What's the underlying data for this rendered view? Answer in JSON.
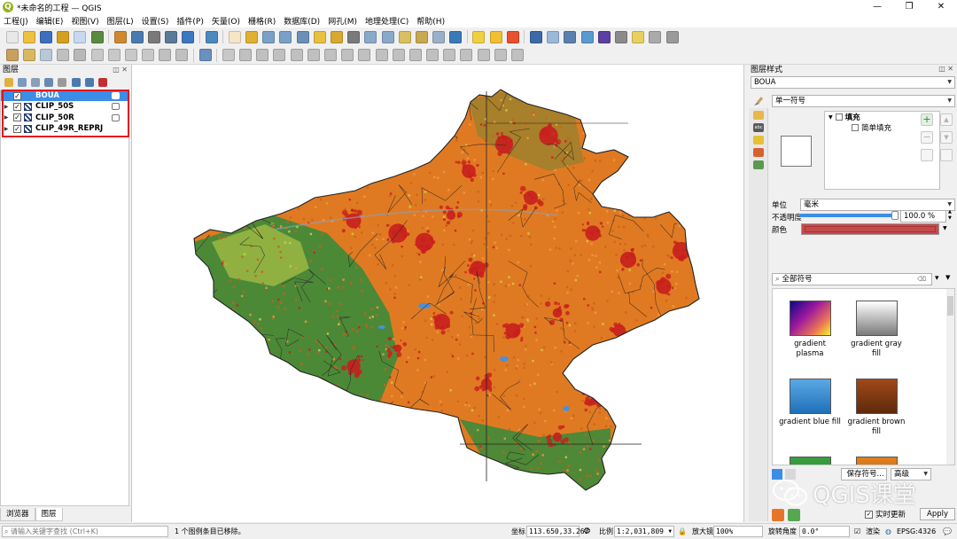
{
  "window": {
    "title": "*未命名的工程 — QGIS",
    "app_logo": "Q",
    "minimize": "—",
    "maximize": "❐",
    "close": "✕"
  },
  "menu": [
    "工程(J)",
    "编辑(E)",
    "视图(V)",
    "图层(L)",
    "设置(S)",
    "插件(P)",
    "矢量(O)",
    "栅格(R)",
    "数据库(D)",
    "网孔(M)",
    "地理处理(C)",
    "帮助(H)"
  ],
  "toolbar1_icons": [
    {
      "name": "new-project-icon",
      "color": "#e8e8e8"
    },
    {
      "name": "open-project-icon",
      "color": "#f0c040"
    },
    {
      "name": "save-project-icon",
      "color": "#3c6fbf"
    },
    {
      "name": "save-as-icon",
      "color": "#d4a020"
    },
    {
      "name": "print-layout-icon",
      "color": "#c8d8f0"
    },
    {
      "name": "style-manager-icon",
      "color": "#5a8a40"
    },
    {
      "name": "sep",
      "color": ""
    },
    {
      "name": "add-vector-icon",
      "color": "#d08830"
    },
    {
      "name": "add-raster-icon",
      "color": "#4a7ab0"
    },
    {
      "name": "add-delimited-icon",
      "color": "#7a7a7a"
    },
    {
      "name": "add-gps-icon",
      "color": "#5a7a9a"
    },
    {
      "name": "add-wms-icon",
      "color": "#3c78c0"
    },
    {
      "name": "sep",
      "color": ""
    },
    {
      "name": "checkmark-icon",
      "color": "#4a8ac0"
    },
    {
      "name": "sep",
      "color": ""
    },
    {
      "name": "pan-icon",
      "color": "#f5e6c8"
    },
    {
      "name": "pan-to-selection-icon",
      "color": "#e0b030"
    },
    {
      "name": "zoom-in-icon",
      "color": "#7aa0c8"
    },
    {
      "name": "zoom-out-icon",
      "color": "#7aa0c8"
    },
    {
      "name": "zoom-full-icon",
      "color": "#6a90b8"
    },
    {
      "name": "zoom-selection-icon",
      "color": "#e8c040"
    },
    {
      "name": "zoom-layer-icon",
      "color": "#d8a830"
    },
    {
      "name": "zoom-native-icon",
      "color": "#7a7a7a"
    },
    {
      "name": "zoom-last-icon",
      "color": "#8aa8c8"
    },
    {
      "name": "zoom-next-icon",
      "color": "#8aa8c8"
    },
    {
      "name": "new-bookmark-icon",
      "color": "#d8c060"
    },
    {
      "name": "show-bookmarks-icon",
      "color": "#c8a850"
    },
    {
      "name": "temporal-icon",
      "color": "#9ab0c8"
    },
    {
      "name": "refresh-icon",
      "color": "#3a7ab8"
    },
    {
      "name": "sep",
      "color": ""
    },
    {
      "name": "select-features-icon",
      "color": "#f0d040"
    },
    {
      "name": "select-value-icon",
      "color": "#f0c030"
    },
    {
      "name": "deselect-icon",
      "color": "#e85030"
    },
    {
      "name": "sep",
      "color": ""
    },
    {
      "name": "identify-icon",
      "color": "#3a6aa8"
    },
    {
      "name": "attribute-table-icon",
      "color": "#9ab8d8"
    },
    {
      "name": "field-calculator-icon",
      "color": "#5a80b0"
    },
    {
      "name": "processing-toolbox-icon",
      "color": "#5a9ad0"
    },
    {
      "name": "statistics-sigma-icon",
      "color": "#5a40a0"
    },
    {
      "name": "measure-icon",
      "color": "#8a8a8a"
    },
    {
      "name": "map-tips-icon",
      "color": "#e8d060"
    },
    {
      "name": "annotation-icon",
      "color": "#aaaaaa"
    },
    {
      "name": "decorations-icon",
      "color": "#9a9a9a"
    }
  ],
  "toolbar2_icons": [
    {
      "name": "current-edits-icon",
      "color": "#c8a060"
    },
    {
      "name": "toggle-editing-icon",
      "color": "#d8b860"
    },
    {
      "name": "save-edits-icon",
      "color": "#b8c8d8"
    },
    {
      "name": "digitize-icon",
      "color": "#c0c0c0"
    },
    {
      "name": "vertex-tool-icon",
      "color": "#b8b8b8"
    },
    {
      "name": "delete-selected-icon",
      "color": "#c8c8c8"
    },
    {
      "name": "cut-features-icon",
      "color": "#c8c8c8"
    },
    {
      "name": "copy-features-icon",
      "color": "#c8c8c8"
    },
    {
      "name": "paste-features-icon",
      "color": "#c8c8c8"
    },
    {
      "name": "undo-icon",
      "color": "#c0c0c0"
    },
    {
      "name": "redo-icon",
      "color": "#c0c0c0"
    },
    {
      "name": "sep",
      "color": ""
    },
    {
      "name": "database-icon",
      "color": "#6a90c0"
    },
    {
      "name": "sep",
      "color": ""
    },
    {
      "name": "digitize-shape-icon",
      "color": "#c8c8c8"
    },
    {
      "name": "move-feature-icon",
      "color": "#c0c0c0"
    },
    {
      "name": "rotate-feature-icon",
      "color": "#c0c0c0"
    },
    {
      "name": "simplify-icon",
      "color": "#c0c0c0"
    },
    {
      "name": "add-ring-icon",
      "color": "#c0c0c0"
    },
    {
      "name": "add-part-icon",
      "color": "#c0c0c0"
    },
    {
      "name": "fill-ring-icon",
      "color": "#c0c0c0"
    },
    {
      "name": "delete-ring-icon",
      "color": "#c0c0c0"
    },
    {
      "name": "delete-part-icon",
      "color": "#c0c0c0"
    },
    {
      "name": "reshape-icon",
      "color": "#c0c0c0"
    },
    {
      "name": "offset-curve-icon",
      "color": "#c0c0c0"
    },
    {
      "name": "split-features-icon",
      "color": "#c0c0c0"
    },
    {
      "name": "split-parts-icon",
      "color": "#c0c0c0"
    },
    {
      "name": "merge-features-icon",
      "color": "#c0c0c0"
    },
    {
      "name": "merge-attributes-icon",
      "color": "#c0c0c0"
    },
    {
      "name": "rotate-point-icon",
      "color": "#c0c0c0"
    },
    {
      "name": "trim-extend-icon",
      "color": "#c0c0c0"
    },
    {
      "name": "label-tool-icon",
      "color": "#c0c0c0"
    }
  ],
  "layers_panel": {
    "title": "图层",
    "buttons": "◫ ✕",
    "toolbar_icons": [
      {
        "name": "open-styling-icon",
        "color": "#e0b040"
      },
      {
        "name": "add-group-icon",
        "color": "#7a9ac0"
      },
      {
        "name": "manage-visibility-icon",
        "color": "#8aa0b8"
      },
      {
        "name": "filter-legend-icon",
        "color": "#6a8ab0"
      },
      {
        "name": "filter-expression-icon",
        "color": "#9a9a9a"
      },
      {
        "name": "expand-all-icon",
        "color": "#4a7ab0"
      },
      {
        "name": "collapse-all-icon",
        "color": "#4a7ab0"
      },
      {
        "name": "remove-layer-icon",
        "color": "#c03030"
      }
    ],
    "layers": [
      {
        "name": "BOUA",
        "selected": true,
        "checked": "✓",
        "expand": "",
        "swatch": "#3c8de6",
        "right_icon": "filter"
      },
      {
        "name": "CLIP_50S",
        "selected": false,
        "checked": "✓",
        "expand": "▶",
        "swatch": "#1f3a6e",
        "right_icon": "indicator"
      },
      {
        "name": "CLIP_50R",
        "selected": false,
        "checked": "✓",
        "expand": "▶",
        "swatch": "#1f3a6e",
        "right_icon": "indicator"
      },
      {
        "name": "CLIP_49R_REPRJ",
        "selected": false,
        "checked": "✓",
        "expand": "▶",
        "swatch": "#1f3a6e",
        "right_icon": ""
      }
    ],
    "tabs": [
      "浏览器",
      "图层"
    ]
  },
  "style_panel": {
    "title": "图层样式",
    "buttons": "◫ ✕",
    "layer_combo": "BOUA",
    "renderer_combo": "单一符号",
    "tree": {
      "root": "填充",
      "child": "简单填充",
      "root_arrow": "▼"
    },
    "unit_label": "单位",
    "unit_value": "毫米",
    "opacity_label": "不透明度",
    "opacity_value": "100.0 %",
    "opacity_fraction": 1.0,
    "color_label": "颜色",
    "color_value": "#c44b4b",
    "search_placeholder": "全部符号",
    "symbols": [
      {
        "label": "gradient\nplasma",
        "gradient": "linear-gradient(135deg,#0d0887 0%,#9c179e 40%,#ed7953 75%,#f0f921 100%)"
      },
      {
        "label": "gradient  gray\nfill",
        "gradient": "linear-gradient(180deg,#ffffff 0%,#7a7a7a 100%)"
      },
      {
        "label": "gradient blue fill",
        "gradient": "linear-gradient(180deg,#5aa9e6 0%,#1f70b8 100%)"
      },
      {
        "label": "gradient brown\nfill",
        "gradient": "linear-gradient(180deg,#a0481a 0%,#5e2a0c 100%)"
      },
      {
        "label": "",
        "gradient": "linear-gradient(180deg,#3aa040 0%,#2a8030 100%)"
      },
      {
        "label": "",
        "gradient": "linear-gradient(180deg,#e08020 0%,#c06010 100%)"
      }
    ],
    "save_symbol": "保存符号...",
    "advanced": "高级",
    "live_update": "实时更新",
    "apply": "Apply"
  },
  "statusbar": {
    "search_placeholder": "请输入关键字查找 (Ctrl+K)",
    "message": "1 个图例条目已移除。",
    "coord_label": "坐标",
    "coord_value": "113.650,33.267",
    "scale_label": "比例",
    "scale_value": "1:2,031,809",
    "magnifier_label": "放大镜",
    "magnifier_value": "100%",
    "rotation_label": "旋转角度",
    "rotation_value": "0.0°",
    "render_label": "渲染",
    "crs_label": "EPSG:4326"
  },
  "watermark": {
    "text": "QGIS课堂"
  },
  "map": {
    "colors": {
      "cropland": "#e07a22",
      "urban": "#c81e1e",
      "forest": "#3f8a3a",
      "grass": "#c8d24a",
      "water": "#4a90d8",
      "boundary": "#222222"
    }
  }
}
